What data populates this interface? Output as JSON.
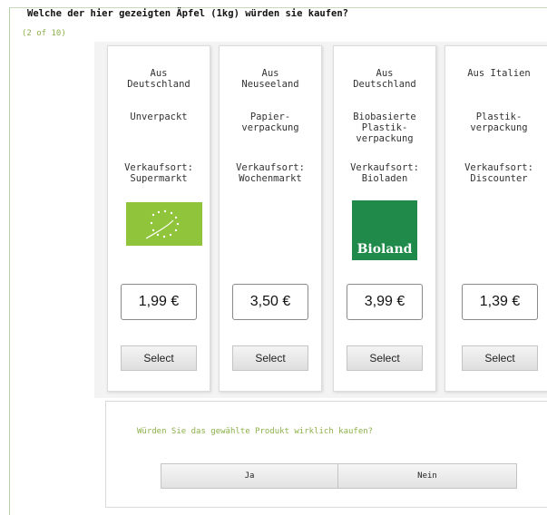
{
  "question": "Welche der hier gezeigten Äpfel (1kg) würden sie kaufen?",
  "progress": "(2 of 10)",
  "products": [
    {
      "origin": [
        "Aus",
        "Deutschland"
      ],
      "packaging": [
        "Unverpackt"
      ],
      "location": [
        "Verkaufsort:",
        "Supermarkt"
      ],
      "logo": "eu-organic-leaf",
      "price": "1,99 €",
      "select_label": "Select"
    },
    {
      "origin": [
        "Aus",
        "Neuseeland"
      ],
      "packaging": [
        "Papier-",
        "verpackung"
      ],
      "location": [
        "Verkaufsort:",
        "Wochenmarkt"
      ],
      "logo": "",
      "price": "3,50 €",
      "select_label": "Select"
    },
    {
      "origin": [
        "Aus",
        "Deutschland"
      ],
      "packaging": [
        "Biobasierte",
        "Plastik-",
        "verpackung"
      ],
      "location": [
        "Verkaufsort:",
        "Bioladen"
      ],
      "logo": "bioland",
      "logo_text": "Bioland",
      "price": "3,99 €",
      "select_label": "Select"
    },
    {
      "origin": [
        "Aus Italien"
      ],
      "packaging": [
        "Plastik-",
        "verpackung"
      ],
      "location": [
        "Verkaufsort:",
        "Discounter"
      ],
      "logo": "",
      "price": "1,39 €",
      "select_label": "Select"
    }
  ],
  "followup": {
    "question": "Würden Sie das gewählte Produkt wirklich kaufen?",
    "yes_label": "Ja",
    "no_label": "Nein"
  },
  "colors": {
    "accent_green": "#8cb04a",
    "eu_leaf_green": "#8fc43b",
    "bioland_green": "#1f8a4a"
  }
}
